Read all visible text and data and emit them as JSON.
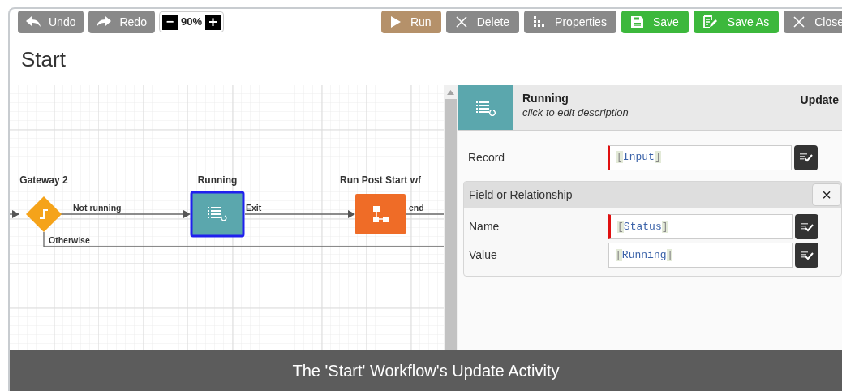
{
  "toolbar": {
    "left_buttons": [
      {
        "label": "Undo"
      },
      {
        "label": "Redo"
      }
    ],
    "zoom": {
      "decrease": "−",
      "value": "90%",
      "increase": "+"
    },
    "right_buttons": [
      {
        "label": "Run",
        "color": "#b5916a"
      },
      {
        "label": "Delete",
        "color": "#898989"
      },
      {
        "label": "Properties",
        "color": "#898989"
      },
      {
        "label": "Save",
        "color": "#3cb83c"
      },
      {
        "label": "Save As",
        "color": "#3cb83c"
      },
      {
        "label": "Close",
        "color": "#898989"
      }
    ]
  },
  "title": "Start",
  "workflow": {
    "nodes": [
      {
        "kind": "gateway",
        "label": "Gateway 2",
        "selected": false
      },
      {
        "kind": "update",
        "label": "Running",
        "selected": true
      },
      {
        "kind": "workflow",
        "label": "Run Post Start wf",
        "selected": false
      }
    ],
    "connectors": [
      {
        "label": "Not running"
      },
      {
        "label": "Exit"
      },
      {
        "label": "end"
      },
      {
        "label": "Otherwise"
      }
    ]
  },
  "panel": {
    "title": "Running",
    "description": "click to edit description",
    "type": "Update",
    "record": {
      "label": "Record",
      "value": "[Input]",
      "required": true
    },
    "section": {
      "title": "Field or Relationship",
      "close": "×",
      "fields": [
        {
          "label": "Name",
          "value": "[Status]",
          "required": true
        },
        {
          "label": "Value",
          "value": "[Running]",
          "required": false
        }
      ]
    }
  },
  "caption": "The 'Start' Workflow's Update Activity"
}
